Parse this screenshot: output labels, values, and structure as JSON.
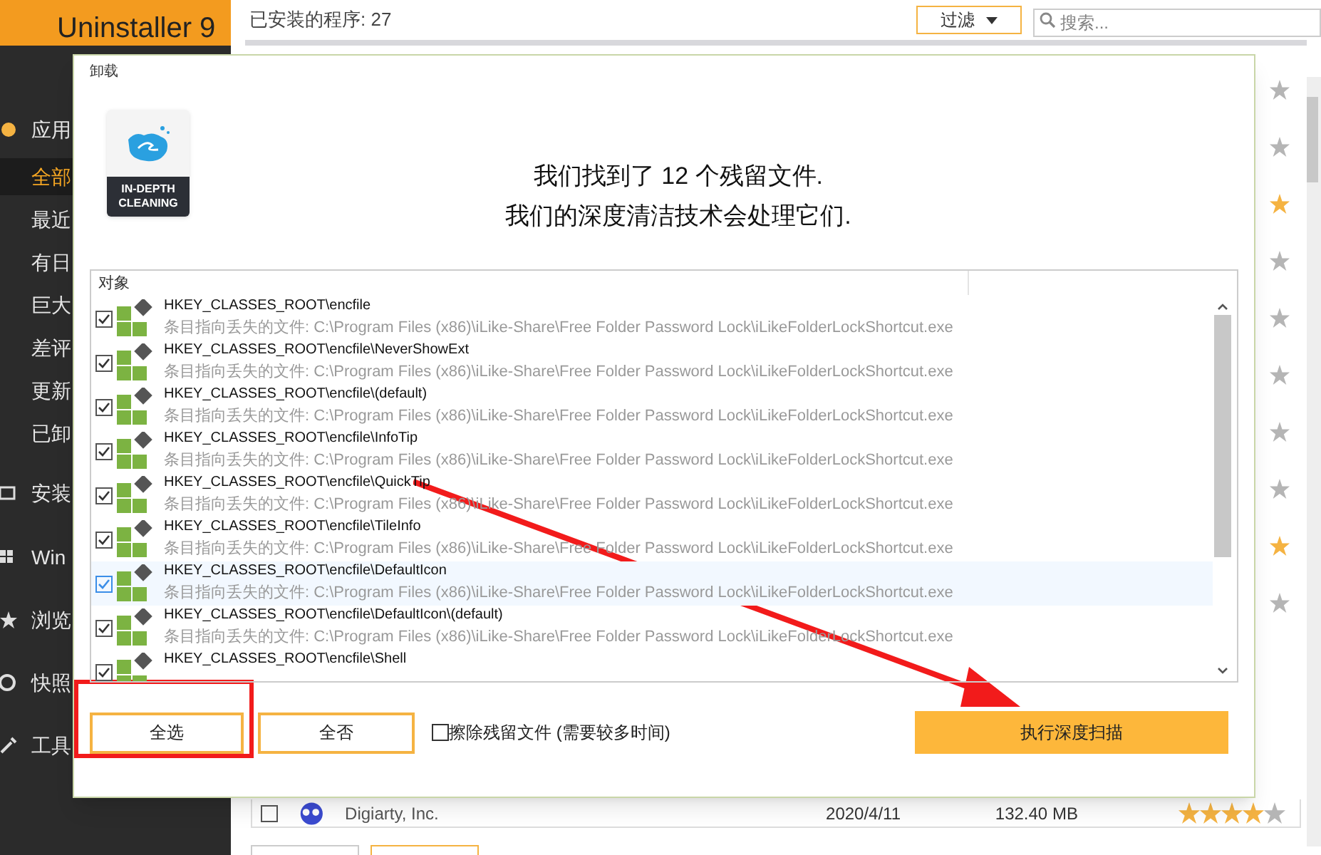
{
  "app": {
    "title": "Uninstaller 9",
    "installed_count": "已安装的程序: 27",
    "filter_button": "过滤",
    "search": {
      "placeholder": "搜索..."
    }
  },
  "sidebar": {
    "items": [
      {
        "label": "应用",
        "kind": "section",
        "selected": false
      },
      {
        "label": "全部",
        "kind": "sub",
        "selected": true
      },
      {
        "label": "最近",
        "kind": "sub",
        "selected": false
      },
      {
        "label": "有日",
        "kind": "sub",
        "selected": false
      },
      {
        "label": "巨大",
        "kind": "sub",
        "selected": false
      },
      {
        "label": "差评",
        "kind": "sub",
        "selected": false
      },
      {
        "label": "更新",
        "kind": "sub",
        "selected": false
      },
      {
        "label": "已卸",
        "kind": "sub",
        "selected": false
      },
      {
        "label": "安装",
        "kind": "section",
        "selected": false
      },
      {
        "label": "Win",
        "kind": "section",
        "selected": false
      },
      {
        "label": "浏览",
        "kind": "section",
        "selected": false
      },
      {
        "label": "快照",
        "kind": "section",
        "selected": false
      },
      {
        "label": "工具",
        "kind": "section",
        "selected": false
      }
    ]
  },
  "background_ratings": [
    {
      "filled": false
    },
    {
      "filled": false
    },
    {
      "filled": true
    },
    {
      "filled": false
    },
    {
      "filled": false
    },
    {
      "filled": false
    },
    {
      "filled": false
    },
    {
      "filled": false
    },
    {
      "filled": true
    },
    {
      "filled": false
    }
  ],
  "background_row": {
    "checked": false,
    "publisher": "Digiarty, Inc.",
    "date": "2020/4/11",
    "size": "132.40 MB",
    "stars": 4
  },
  "dialog": {
    "title": "卸载",
    "badge": "IN-DEPTH CLEANING",
    "heading": [
      "我们找到了 12 个残留文件.",
      "我们的深度清洁技术会处理它们."
    ],
    "list": {
      "column": "对象",
      "rows": [
        {
          "name": "HKEY_CLASSES_ROOT\\encfile",
          "path": "条目指向丢失的文件: C:\\Program Files (x86)\\iLike-Share\\Free Folder Password Lock\\iLikeFolderLockShortcut.exe",
          "checked": true,
          "focused": false
        },
        {
          "name": "HKEY_CLASSES_ROOT\\encfile\\NeverShowExt",
          "path": "条目指向丢失的文件: C:\\Program Files (x86)\\iLike-Share\\Free Folder Password Lock\\iLikeFolderLockShortcut.exe",
          "checked": true,
          "focused": false
        },
        {
          "name": "HKEY_CLASSES_ROOT\\encfile\\(default)",
          "path": "条目指向丢失的文件: C:\\Program Files (x86)\\iLike-Share\\Free Folder Password Lock\\iLikeFolderLockShortcut.exe",
          "checked": true,
          "focused": false
        },
        {
          "name": "HKEY_CLASSES_ROOT\\encfile\\InfoTip",
          "path": "条目指向丢失的文件: C:\\Program Files (x86)\\iLike-Share\\Free Folder Password Lock\\iLikeFolderLockShortcut.exe",
          "checked": true,
          "focused": false
        },
        {
          "name": "HKEY_CLASSES_ROOT\\encfile\\QuickTip",
          "path": "条目指向丢失的文件: C:\\Program Files (x86)\\iLike-Share\\Free Folder Password Lock\\iLikeFolderLockShortcut.exe",
          "checked": true,
          "focused": false
        },
        {
          "name": "HKEY_CLASSES_ROOT\\encfile\\TileInfo",
          "path": "条目指向丢失的文件: C:\\Program Files (x86)\\iLike-Share\\Free Folder Password Lock\\iLikeFolderLockShortcut.exe",
          "checked": true,
          "focused": false
        },
        {
          "name": "HKEY_CLASSES_ROOT\\encfile\\DefaultIcon",
          "path": "条目指向丢失的文件: C:\\Program Files (x86)\\iLike-Share\\Free Folder Password Lock\\iLikeFolderLockShortcut.exe",
          "checked": true,
          "focused": true
        },
        {
          "name": "HKEY_CLASSES_ROOT\\encfile\\DefaultIcon\\(default)",
          "path": "条目指向丢失的文件: C:\\Program Files (x86)\\iLike-Share\\Free Folder Password Lock\\iLikeFolderLockShortcut.exe",
          "checked": true,
          "focused": false
        },
        {
          "name": "HKEY_CLASSES_ROOT\\encfile\\Shell",
          "checked": true,
          "focused": false
        }
      ]
    },
    "select_all": "全选",
    "select_none": "全否",
    "erase_option": {
      "label": "擦除残留文件 (需要较多时间)",
      "checked": false
    },
    "scan_button": "执行深度扫描"
  }
}
